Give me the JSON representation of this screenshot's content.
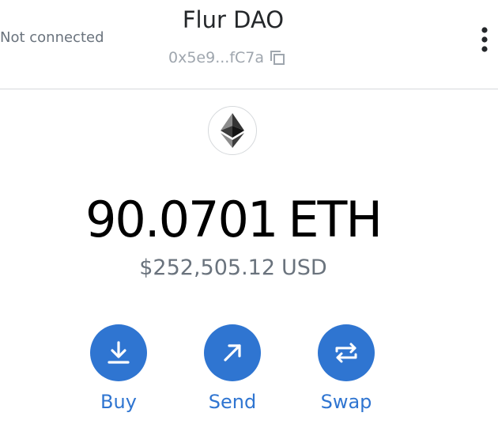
{
  "header": {
    "connection_status": "Not connected",
    "account_name": "Flur DAO",
    "address": "0x5e9...fC7a",
    "copy_icon": "copy-icon",
    "menu_icon": "kebab-menu-icon"
  },
  "token": {
    "logo_icon": "ethereum-icon",
    "balance": "90.0701",
    "currency": "ETH",
    "fiat_amount": "$252,505.12",
    "fiat_currency": "USD"
  },
  "actions": [
    {
      "label": "Buy",
      "icon": "download-icon"
    },
    {
      "label": "Send",
      "icon": "arrow-up-right-icon"
    },
    {
      "label": "Swap",
      "icon": "swap-arrows-icon"
    }
  ],
  "colors": {
    "accent": "#2f75d1",
    "muted_text": "#6a737d",
    "address_text": "#9fa6ae",
    "divider": "#d6d9dc"
  }
}
